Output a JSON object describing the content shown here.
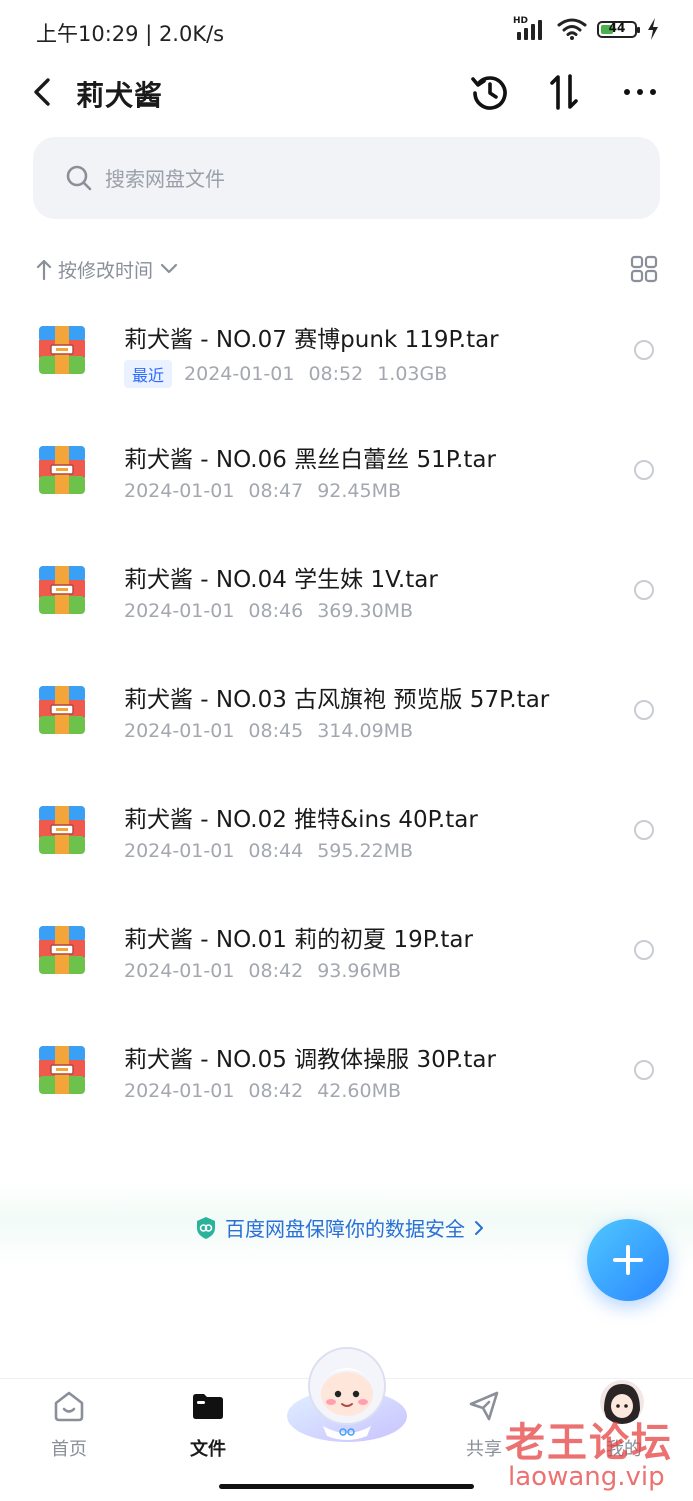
{
  "status_bar": {
    "time": "上午10:29 | 2.0K/s",
    "signal_tag": "HD",
    "battery": "44",
    "battery_level": 0.44
  },
  "header": {
    "title": "莉犬酱",
    "icons": [
      "back-icon",
      "history-icon",
      "sort-icon",
      "more-icon"
    ]
  },
  "search": {
    "placeholder": "搜索网盘文件"
  },
  "sort": {
    "label": "按修改时间"
  },
  "files": [
    {
      "name": "莉犬酱 - NO.07 赛博punk 119P.tar",
      "badge": "最近",
      "date": "2024-01-01",
      "time": "08:52",
      "size": "1.03GB"
    },
    {
      "name": "莉犬酱 - NO.06 黑丝白蕾丝 51P.tar",
      "badge": "",
      "date": "2024-01-01",
      "time": "08:47",
      "size": "92.45MB"
    },
    {
      "name": "莉犬酱 - NO.04 学生妹 1V.tar",
      "badge": "",
      "date": "2024-01-01",
      "time": "08:46",
      "size": "369.30MB"
    },
    {
      "name": "莉犬酱 - NO.03 古风旗袍 预览版 57P.tar",
      "badge": "",
      "date": "2024-01-01",
      "time": "08:45",
      "size": "314.09MB"
    },
    {
      "name": "莉犬酱 - NO.02 推特&ins 40P.tar",
      "badge": "",
      "date": "2024-01-01",
      "time": "08:44",
      "size": "595.22MB"
    },
    {
      "name": "莉犬酱 - NO.01 莉的初夏 19P.tar",
      "badge": "",
      "date": "2024-01-01",
      "time": "08:42",
      "size": "93.96MB"
    },
    {
      "name": "莉犬酱 - NO.05 调教体操服 30P.tar",
      "badge": "",
      "date": "2024-01-01",
      "time": "08:42",
      "size": "42.60MB"
    }
  ],
  "banner": {
    "text": "百度网盘保障你的数据安全"
  },
  "tabs": [
    {
      "label": "首页",
      "icon": "home-icon"
    },
    {
      "label": "文件",
      "icon": "folder-icon"
    },
    {
      "label": "共享",
      "icon": "share-icon"
    },
    {
      "label": "我的",
      "icon": "avatar"
    }
  ],
  "watermark": {
    "line1": "老王论坛",
    "line2": "laowang.vip"
  },
  "colors": {
    "accent": "#2a86ff",
    "badge_text": "#2f6bff",
    "banner_text": "#2a6fd8",
    "watermark": "#e43a3a"
  }
}
